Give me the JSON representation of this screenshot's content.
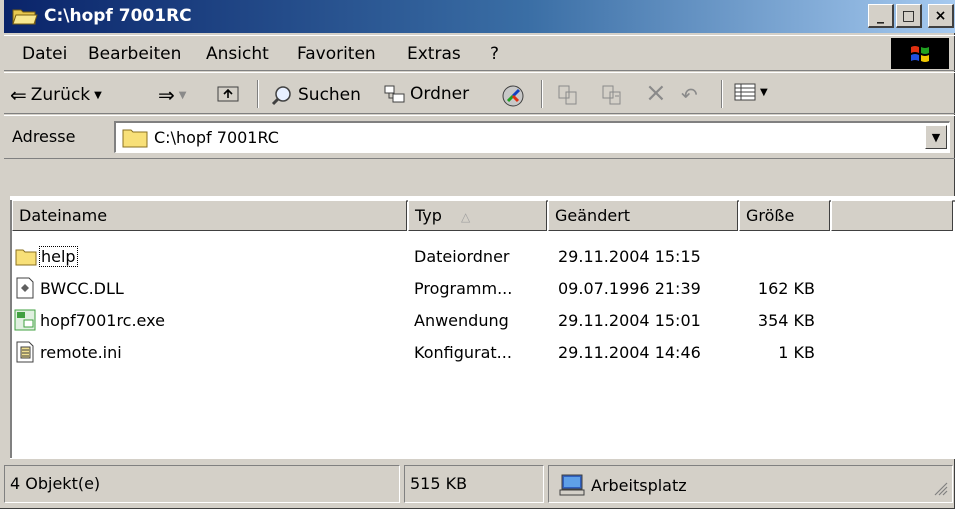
{
  "window": {
    "title": "C:\\hopf 7001RC",
    "controls": {
      "minimize": "_",
      "maximize": "□",
      "close": "×"
    }
  },
  "menu": [
    {
      "label": "Datei"
    },
    {
      "label": "Bearbeiten"
    },
    {
      "label": "Ansicht"
    },
    {
      "label": "Favoriten"
    },
    {
      "label": "Extras"
    },
    {
      "label": "?"
    }
  ],
  "toolbar": {
    "back_label": "Zurück",
    "search_label": "Suchen",
    "folders_label": "Ordner"
  },
  "address": {
    "label": "Adresse",
    "value": "C:\\hopf 7001RC"
  },
  "columns": {
    "name": "Dateiname",
    "type": "Typ",
    "modified": "Geändert",
    "size": "Größe"
  },
  "files": [
    {
      "name": "help",
      "type": "Dateiordner",
      "modified": "29.11.2004 15:15",
      "size": "",
      "icon": "folder-icon"
    },
    {
      "name": "BWCC.DLL",
      "type": "Programm...",
      "modified": "09.07.1996 21:39",
      "size": "162 KB",
      "icon": "dll-icon"
    },
    {
      "name": "hopf7001rc.exe",
      "type": "Anwendung",
      "modified": "29.11.2004 15:01",
      "size": "354 KB",
      "icon": "hopf-exe-icon"
    },
    {
      "name": "remote.ini",
      "type": "Konfigurat...",
      "modified": "29.11.2004 14:46",
      "size": "1 KB",
      "icon": "ini-icon"
    }
  ],
  "status": {
    "objects": "4 Objekt(e)",
    "total_size": "515 KB",
    "location": "Arbeitsplatz"
  },
  "colors": {
    "titlebar_start": "#0a246a",
    "titlebar_end": "#a6caf0",
    "chrome": "#d4d0c8"
  }
}
